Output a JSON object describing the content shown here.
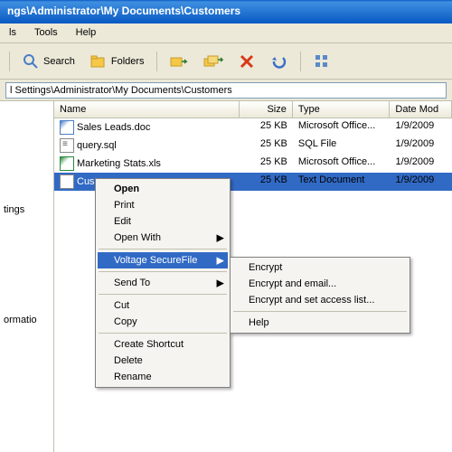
{
  "titlebar": "ngs\\Administrator\\My Documents\\Customers",
  "menu": {
    "tools": "Tools",
    "help": "Help"
  },
  "toolbar": {
    "search": "Search",
    "folders": "Folders"
  },
  "address": "l Settings\\Administrator\\My Documents\\Customers",
  "columns": {
    "name": "Name",
    "size": "Size",
    "type": "Type",
    "date": "Date Mod"
  },
  "files": [
    {
      "name": "Sales Leads.doc",
      "size": "25 KB",
      "type": "Microsoft Office...",
      "date": "1/9/2009"
    },
    {
      "name": "query.sql",
      "size": "25 KB",
      "type": "SQL File",
      "date": "1/9/2009"
    },
    {
      "name": "Marketing Stats.xls",
      "size": "25 KB",
      "type": "Microsoft Office...",
      "date": "1/9/2009"
    },
    {
      "name": "Cus",
      "size": "25 KB",
      "type": "Text Document",
      "date": "1/9/2009"
    }
  ],
  "sidebar": {
    "sec1": "tings",
    "sec2": "ormatio"
  },
  "context": {
    "open": "Open",
    "print": "Print",
    "edit": "Edit",
    "openwith": "Open With",
    "voltage": "Voltage SecureFile",
    "sendto": "Send To",
    "cut": "Cut",
    "copy": "Copy",
    "shortcut": "Create Shortcut",
    "delete": "Delete",
    "rename": "Rename"
  },
  "submenu": {
    "encrypt": "Encrypt",
    "email": "Encrypt and email...",
    "access": "Encrypt and set access list...",
    "help": "Help"
  }
}
